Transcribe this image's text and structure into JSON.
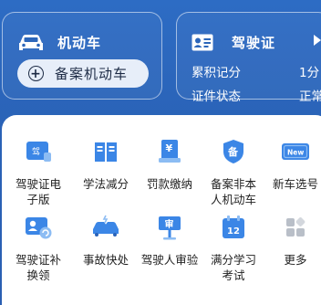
{
  "vehicle_card": {
    "title": "机动车",
    "register_button": "备案机动车"
  },
  "license_card": {
    "title": "驾驶证",
    "points_label": "累积记分",
    "points_value": "1分",
    "status_label": "证件状态",
    "status_value": "正常"
  },
  "services": [
    {
      "label": "驾驶证电子版",
      "icon": "e-license-icon",
      "badge": "驾"
    },
    {
      "label": "学法减分",
      "icon": "book-icon"
    },
    {
      "label": "罚款缴纳",
      "icon": "fine-receipt-icon",
      "badge": "¥"
    },
    {
      "label": "备案非本人机动车",
      "icon": "shield-car-icon",
      "badge": "备"
    },
    {
      "label": "新车选号",
      "icon": "new-plate-icon",
      "badge": "New"
    },
    {
      "label": "驾驶证补换领",
      "icon": "license-replace-icon"
    },
    {
      "label": "事故快处",
      "icon": "accident-icon"
    },
    {
      "label": "驾驶人审验",
      "icon": "review-sign-icon",
      "badge": "审"
    },
    {
      "label": "满分学习考试",
      "icon": "calendar-exam-icon",
      "badge": "12"
    },
    {
      "label": "更多",
      "icon": "more-grid-icon"
    }
  ],
  "colors": {
    "background": "#2a63b8",
    "accent_blue": "#2f7be0",
    "light_blue": "#8ab8f2"
  }
}
